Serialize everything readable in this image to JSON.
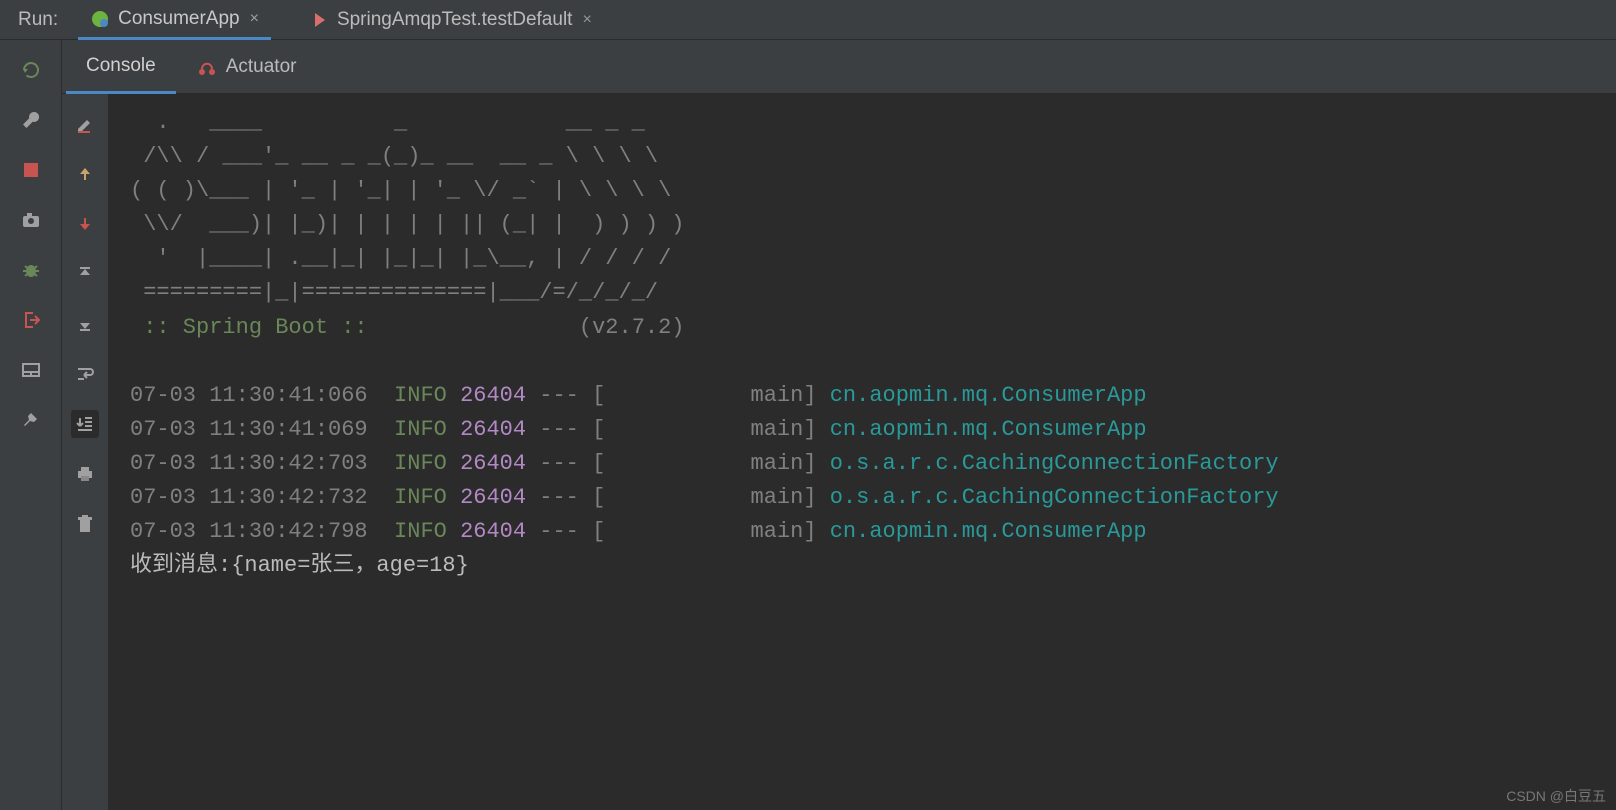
{
  "header": {
    "label": "Run:",
    "tabs": [
      {
        "label": "ConsumerApp",
        "active": true
      },
      {
        "label": "SpringAmqpTest.testDefault",
        "active": false
      }
    ]
  },
  "subTabs": [
    {
      "label": "Console",
      "active": true
    },
    {
      "label": "Actuator",
      "active": false
    }
  ],
  "console": {
    "bannerLines": [
      "  .   ____          _            __ _ _",
      " /\\\\ / ___'_ __ _ _(_)_ __  __ _ \\ \\ \\ \\",
      "( ( )\\___ | '_ | '_| | '_ \\/ _` | \\ \\ \\ \\",
      " \\\\/  ___)| |_)| | | | | || (_| |  ) ) ) )",
      "  '  |____| .__|_| |_|_| |_\\__, | / / / /",
      " =========|_|==============|___/=/_/_/_/"
    ],
    "springBootLabel": " :: Spring Boot :: ",
    "springBootVersion": "(v2.7.2)",
    "logs": [
      {
        "ts": "07-03 11:30:41:066",
        "level": "INFO",
        "pid": "26404",
        "thread": "main",
        "class": "cn.aopmin.mq.ConsumerApp"
      },
      {
        "ts": "07-03 11:30:41:069",
        "level": "INFO",
        "pid": "26404",
        "thread": "main",
        "class": "cn.aopmin.mq.ConsumerApp"
      },
      {
        "ts": "07-03 11:30:42:703",
        "level": "INFO",
        "pid": "26404",
        "thread": "main",
        "class": "o.s.a.r.c.CachingConnectionFactory"
      },
      {
        "ts": "07-03 11:30:42:732",
        "level": "INFO",
        "pid": "26404",
        "thread": "main",
        "class": "o.s.a.r.c.CachingConnectionFactory"
      },
      {
        "ts": "07-03 11:30:42:798",
        "level": "INFO",
        "pid": "26404",
        "thread": "main",
        "class": "cn.aopmin.mq.ConsumerApp"
      }
    ],
    "message": "收到消息:{name=张三，age=18}"
  },
  "watermark": "CSDN @白豆五"
}
